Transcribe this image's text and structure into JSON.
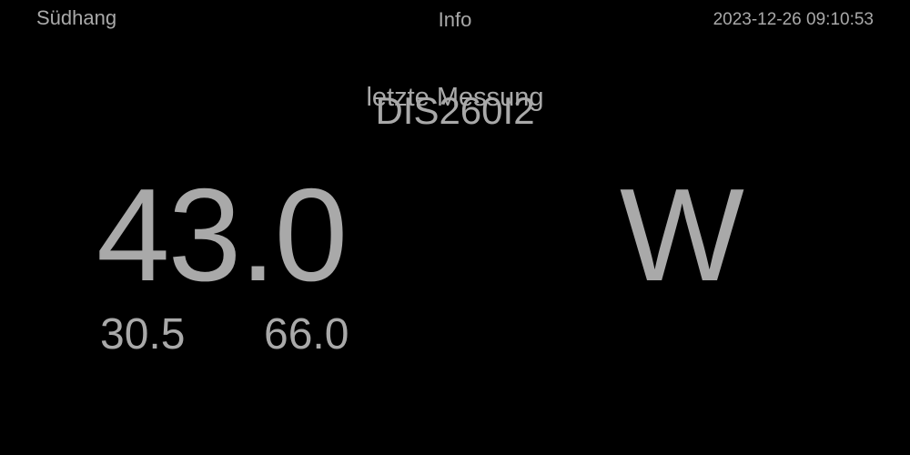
{
  "header": {
    "location": "Südhang",
    "info_label": "Info",
    "datetime": "2023-12-26 09:10:53"
  },
  "sensor": {
    "name": "DIS260I2",
    "caption": "letzte Messung",
    "value": "43.0",
    "unit": "W",
    "min": "30.5",
    "max": "66.0"
  },
  "colors": {
    "background": "#000000",
    "text": "#a9a9a9"
  }
}
